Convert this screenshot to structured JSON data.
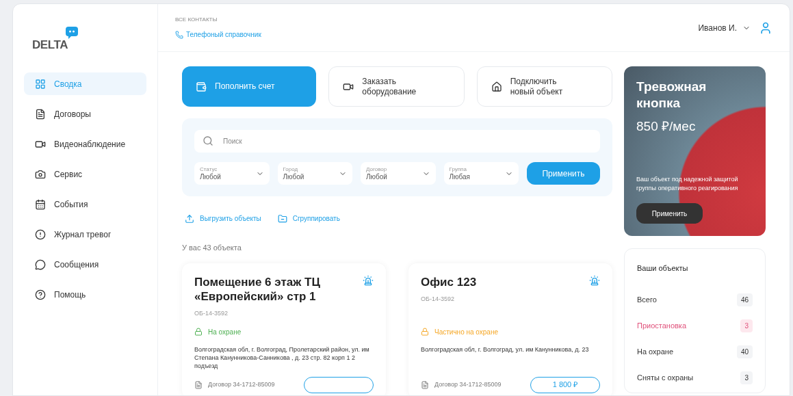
{
  "logo": {
    "text": "DELTA"
  },
  "sidebar": {
    "items": [
      {
        "label": "Сводка",
        "selected": true
      },
      {
        "label": "Договоры",
        "selected": false
      },
      {
        "label": "Видеонаблюдение",
        "selected": false
      },
      {
        "label": "Сервис",
        "selected": false
      },
      {
        "label": "События",
        "selected": false
      },
      {
        "label": "Журнал тревог",
        "selected": false
      },
      {
        "label": "Сообщения",
        "selected": false
      },
      {
        "label": "Помощь",
        "selected": false
      }
    ]
  },
  "header": {
    "contacts_label": "ВСЕ КОНТАКТЫ",
    "phonebook_link": "Телефоный справочник",
    "user": "Иванов И."
  },
  "actions": [
    {
      "label": "Пополнить счет",
      "primary": true
    },
    {
      "label": "Заказать оборудование",
      "primary": false
    },
    {
      "label": "Подключить новый объект",
      "primary": false
    }
  ],
  "filters": {
    "search_placeholder": "Поиск",
    "selects": [
      {
        "label": "Статус",
        "value": "Любой"
      },
      {
        "label": "Город",
        "value": "Любой"
      },
      {
        "label": "Договор",
        "value": "Любой"
      },
      {
        "label": "Группа",
        "value": "Любая"
      }
    ],
    "apply": "Применить"
  },
  "links": [
    {
      "label": "Выгрузить объекты"
    },
    {
      "label": "Сгруппировать"
    }
  ],
  "count": "У вас 43 объекта",
  "objects": [
    {
      "title": "Помещение 6 этаж ТЦ «Европейский» стр 1",
      "code": "ОБ-14-3592",
      "status": "На охране",
      "kind": "armed",
      "address": "Волгоградская обл, г. Волгоград, Пролетарский район, ул. им Степана Канунникова-Санникова , д. 23 стр. 82 корп 1 2 подъезд",
      "contract": "Договор 34-1712-85009"
    },
    {
      "title": "Офис 123",
      "code": "ОБ-14-3592",
      "status": "Частично на охране",
      "kind": "partial",
      "address": "Волгоградская обл, г. Волгоград, ул. им Канунникова, д. 23",
      "contract": "Договор 34-1712-85009",
      "price": "1 800 ₽"
    }
  ],
  "promo": {
    "title": "Тревожная кнопка",
    "price": "850 ₽/мес",
    "text": "Ваш объект под надежной защитой группы оперативного реагирования",
    "button": "Применить"
  },
  "stats": {
    "title": "Ваши объекты",
    "rows": [
      {
        "label": "Всего",
        "value": "46",
        "kind": "normal"
      },
      {
        "label": "Приостановка",
        "value": "3",
        "kind": "warning"
      },
      {
        "label": "На охране",
        "value": "40",
        "kind": "normal"
      },
      {
        "label": "Сняты с охраны",
        "value": "3",
        "kind": "normal"
      }
    ]
  }
}
